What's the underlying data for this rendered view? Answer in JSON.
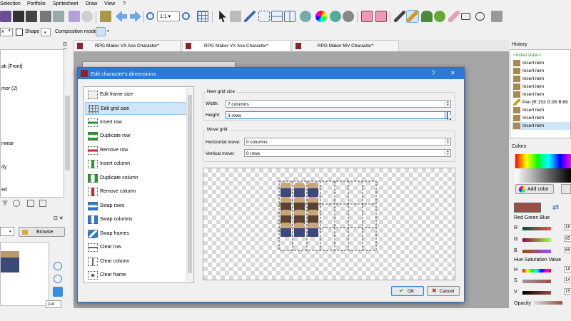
{
  "menu": {
    "items": [
      "Selection",
      "Portfolio",
      "Spritesheet",
      "Draw",
      "View",
      "?"
    ]
  },
  "options": {
    "size_value": "x",
    "shape_label": "Shape",
    "composition_label": "Composition mode"
  },
  "tabs": [
    {
      "label": "RPG Maker VX Ace Character*"
    },
    {
      "label": "RPG Maker VX Ace Character*"
    },
    {
      "label": "RPG Maker MV Character*"
    }
  ],
  "left_panel": {
    "items": [
      "ak [Front]",
      "mor (2)",
      "rwear",
      "dy",
      "ed"
    ],
    "browse_label": "Browse",
    "page": "1/4"
  },
  "dialog": {
    "title": "Edit character's dimensions",
    "help": "?",
    "close": "✕",
    "actions": [
      {
        "label": "Edit frame size",
        "icon": "edit-frame-size-icon"
      },
      {
        "label": "Edit grid size",
        "icon": "edit-grid-size-icon"
      },
      {
        "label": "Insert row",
        "icon": "insert-row-icon"
      },
      {
        "label": "Duplicate row",
        "icon": "duplicate-row-icon"
      },
      {
        "label": "Remove row",
        "icon": "remove-row-icon"
      },
      {
        "label": "Insert column",
        "icon": "insert-column-icon"
      },
      {
        "label": "Duplicate column",
        "icon": "duplicate-column-icon"
      },
      {
        "label": "Remove column",
        "icon": "remove-column-icon"
      },
      {
        "label": "Swap rows",
        "icon": "swap-rows-icon"
      },
      {
        "label": "Swap columns",
        "icon": "swap-columns-icon"
      },
      {
        "label": "Swap frames",
        "icon": "swap-frames-icon"
      },
      {
        "label": "Clear row",
        "icon": "clear-row-icon"
      },
      {
        "label": "Clear column",
        "icon": "clear-column-icon"
      },
      {
        "label": "Clear frame",
        "icon": "clear-frame-icon"
      }
    ],
    "selected_action": 1,
    "new_grid": {
      "title": "New grid size",
      "width_label": "Width:",
      "width_value": "7 columns",
      "height_label": "Height:",
      "height_value": "3 rows"
    },
    "move_grid": {
      "title": "Move grid",
      "h_label": "Horizontal move:",
      "h_value": "0 columns",
      "v_label": "Vertical move:",
      "v_value": "0 rows"
    },
    "ok_label": "OK",
    "cancel_label": "Cancel"
  },
  "history": {
    "title": "History",
    "items": [
      "<Initial state>",
      "Insert item",
      "Insert item",
      "Insert item",
      "Insert item",
      "Insert item",
      "Pen [R:153 G:95 B:69",
      "Insert item",
      "Insert item",
      "Insert item"
    ],
    "selected": 9
  },
  "colors": {
    "title": "Colors",
    "add_color_label": "Add color",
    "rgb_title": "Red Green Blue",
    "r_label": "R",
    "g_label": "G",
    "b_label": "B",
    "r_value": "15",
    "g_value": "95",
    "b_value": "69",
    "hsv_title": "Hue Saturation Value",
    "h_label": "H",
    "s_label": "S",
    "v_label": "V",
    "h_value": "18",
    "s_value": "14",
    "v_value": "15",
    "opacity_label": "Opacity",
    "current_color": "#994f45"
  }
}
